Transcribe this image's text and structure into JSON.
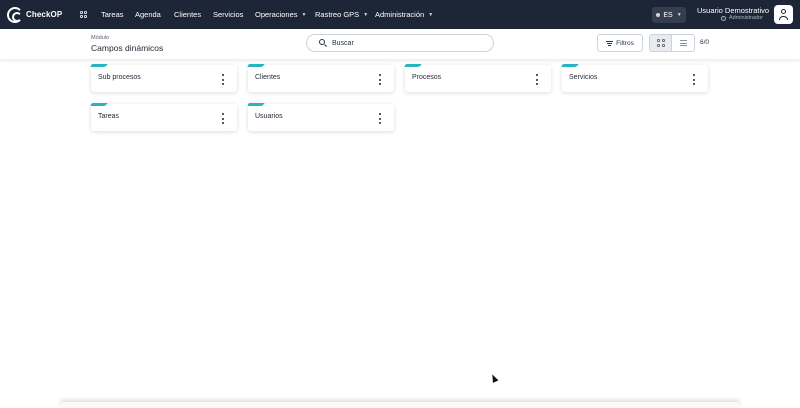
{
  "app": {
    "logo_text": "CheckOP"
  },
  "nav": {
    "items": [
      {
        "label": "Tareas"
      },
      {
        "label": "Agenda"
      },
      {
        "label": "Clientes"
      },
      {
        "label": "Servicios"
      },
      {
        "label": "Operaciones",
        "dropdown": true
      },
      {
        "label": "Rastreo GPS",
        "dropdown": true
      },
      {
        "label": "Administración",
        "dropdown": true
      }
    ],
    "caret": "▼"
  },
  "language": {
    "value": "ES"
  },
  "user": {
    "name": "Usuario Demostrativo",
    "role": "Administrador"
  },
  "header": {
    "module_label": "Módulo",
    "page_title": "Campos dinámicos",
    "search_placeholder": "Buscar",
    "filters_label": "Filtros",
    "count": "6/0"
  },
  "cards": [
    {
      "title": "Sub procesos"
    },
    {
      "title": "Clientes"
    },
    {
      "title": "Procesos"
    },
    {
      "title": "Servicios"
    },
    {
      "title": "Tareas"
    },
    {
      "title": "Usuarios"
    }
  ],
  "colors": {
    "topbar": "#1d2636",
    "accent": "#28b3c0"
  },
  "icons": {
    "logo": "checkop-logo-icon",
    "apps": "grid-apps-icon",
    "search": "search-icon",
    "filter": "filter-icon",
    "grid_view": "grid-view-icon",
    "list_view": "list-view-icon",
    "avatar": "user-avatar-icon",
    "card_menu": "more-vertical-icon"
  }
}
